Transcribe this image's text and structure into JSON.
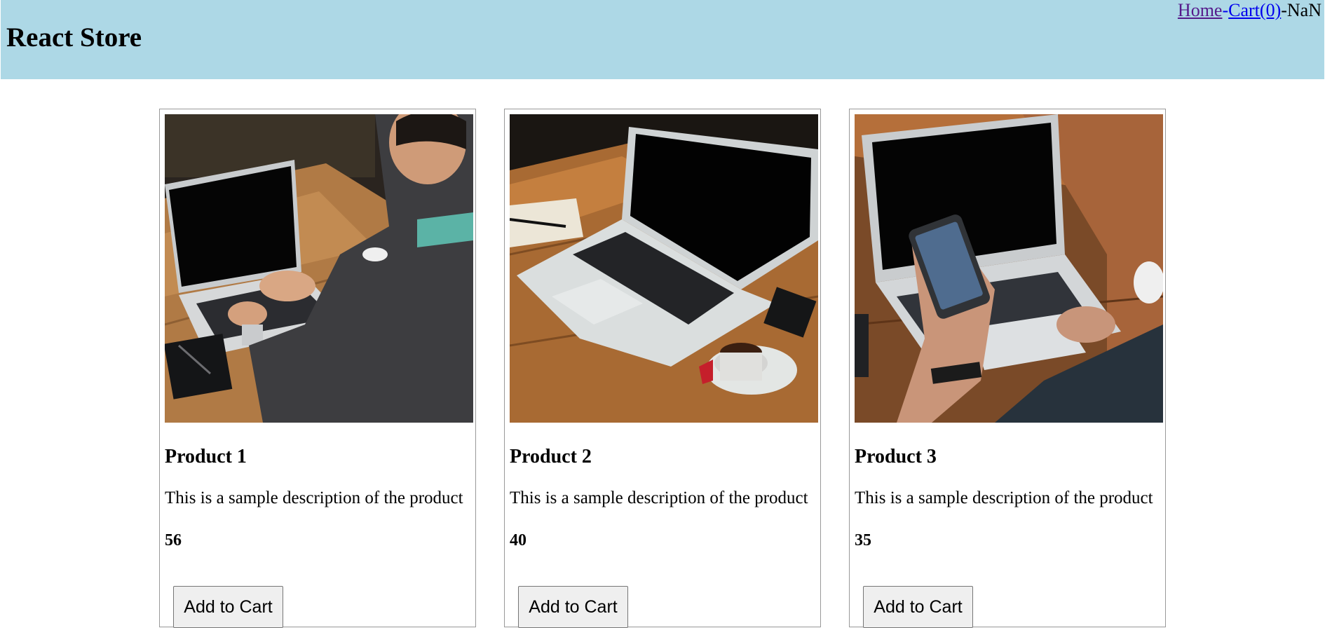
{
  "header": {
    "title": "React Store",
    "nav": {
      "home_label": "Home",
      "separator_1": "-",
      "cart_label": "Cart(0)",
      "separator_2": "-",
      "total_text": "NaN"
    },
    "background_color": "#add8e6"
  },
  "products": [
    {
      "name": "Product 1",
      "description": "This is a sample description of the product",
      "price": "56",
      "button_label": "Add to Cart",
      "image_subject": "person typing on laptop at wooden table"
    },
    {
      "name": "Product 2",
      "description": "This is a sample description of the product",
      "price": "40",
      "button_label": "Add to Cart",
      "image_subject": "open laptop on wooden table with coffee cup and notebook"
    },
    {
      "name": "Product 3",
      "description": "This is a sample description of the product",
      "price": "35",
      "button_label": "Add to Cart",
      "image_subject": "hand holding smartphone in front of laptop"
    }
  ]
}
